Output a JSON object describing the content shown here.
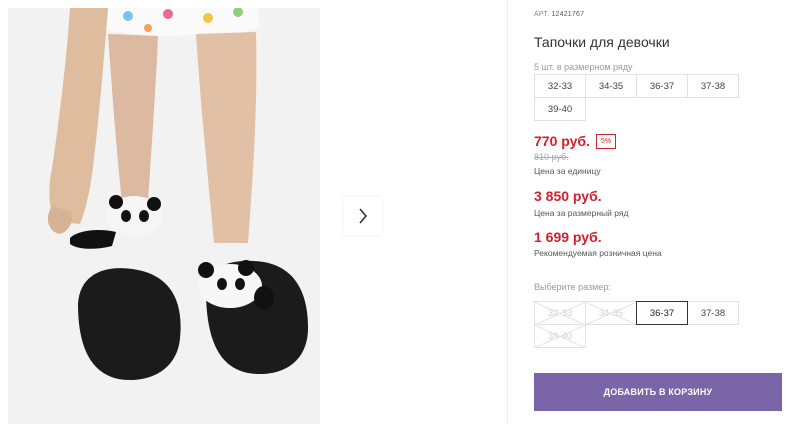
{
  "product": {
    "sku_label": "АРТ.",
    "sku_value": "12421767",
    "title": "Тапочки для девочки"
  },
  "pack": {
    "label": "5 шт. в размерном ряду",
    "sizes": [
      "32-33",
      "34-35",
      "36-37",
      "37-38",
      "39-40"
    ]
  },
  "prices": {
    "unit_price": "770 руб.",
    "discount_badge": "5%",
    "old_price": "810 руб.",
    "unit_caption": "Цена за единицу",
    "pack_price": "3 850 руб.",
    "pack_caption": "Цена за размерный ряд",
    "retail_price": "1 699 руб.",
    "retail_caption": "Рекомендуемая розничная цена"
  },
  "size_select": {
    "label": "Выберите размер:",
    "options": [
      {
        "label": "32-33",
        "state": "disabled"
      },
      {
        "label": "34-35",
        "state": "disabled"
      },
      {
        "label": "36-37",
        "state": "selected"
      },
      {
        "label": "37-38",
        "state": "available"
      },
      {
        "label": "39-40",
        "state": "disabled"
      }
    ]
  },
  "cart_button": {
    "label": "ДОБАВИТЬ В КОРЗИНУ"
  },
  "gallery": {
    "next_icon": "chevron-right-icon"
  },
  "colors": {
    "accent_purple": "#7a65a8",
    "price_red": "#d3202e",
    "slipper_black": "#1b1b1b"
  }
}
